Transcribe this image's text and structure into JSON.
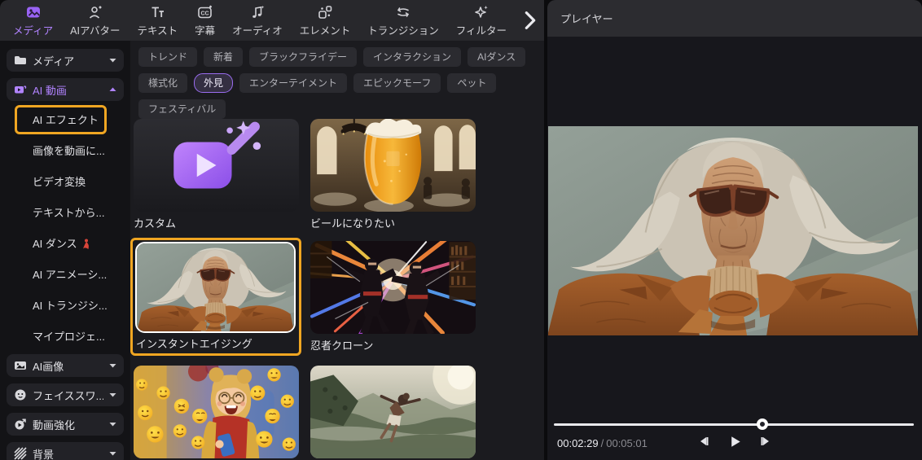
{
  "colors": {
    "accent_purple": "#A47CFF",
    "highlight_orange": "#F0A622",
    "chip_selected_border": "#9A6CF0"
  },
  "toolbar": {
    "items": [
      {
        "label": "メディア",
        "selected": true
      },
      {
        "label": "AIアバター",
        "selected": false
      },
      {
        "label": "テキスト",
        "selected": false
      },
      {
        "label": "字幕",
        "selected": false
      },
      {
        "label": "オーディオ",
        "selected": false
      },
      {
        "label": "エレメント",
        "selected": false
      },
      {
        "label": "トランジション",
        "selected": false
      },
      {
        "label": "フィルター",
        "selected": false
      }
    ]
  },
  "sidebar": {
    "sections": [
      {
        "label": "メディア",
        "state": "collapsed"
      },
      {
        "label": "AI 動画",
        "state": "expanded"
      }
    ],
    "ai_video_items": [
      {
        "label": "AI エフェクト",
        "highlighted": true
      },
      {
        "label": "画像を動画に...",
        "highlighted": false
      },
      {
        "label": "ビデオ変換",
        "highlighted": false
      },
      {
        "label": "テキストから...",
        "highlighted": false
      },
      {
        "label": "AI ダンス",
        "highlighted": false
      },
      {
        "label": "AI アニメーシ...",
        "highlighted": false
      },
      {
        "label": "AI トランジシ...",
        "highlighted": false
      },
      {
        "label": "マイプロジェ...",
        "highlighted": false
      }
    ],
    "bottom_sections": [
      {
        "label": "AI画像"
      },
      {
        "label": "フェイススワ..."
      },
      {
        "label": "動画強化"
      },
      {
        "label": "背景"
      }
    ]
  },
  "filters": {
    "items": [
      {
        "label": "トレンド",
        "selected": false
      },
      {
        "label": "新着",
        "selected": false
      },
      {
        "label": "ブラックフライデー",
        "selected": false
      },
      {
        "label": "インタラクション",
        "selected": false
      },
      {
        "label": "AIダンス",
        "selected": false
      },
      {
        "label": "様式化",
        "selected": false
      },
      {
        "label": "外見",
        "selected": true
      },
      {
        "label": "エンターテイメント",
        "selected": false
      },
      {
        "label": "エピックモーフ",
        "selected": false
      },
      {
        "label": "ペット",
        "selected": false
      },
      {
        "label": "フェスティバル",
        "selected": false
      }
    ]
  },
  "grid": {
    "cards": [
      {
        "label": "カスタム",
        "selected": false
      },
      {
        "label": "ビールになりたい",
        "selected": false
      },
      {
        "label": "インスタントエイジング",
        "selected": true
      },
      {
        "label": "忍者クローン",
        "selected": false
      }
    ]
  },
  "player": {
    "title": "プレイヤー",
    "current_time": "00:02:29",
    "time_separator": "/",
    "total_time": "00:05:01",
    "progress_percent": 58
  }
}
